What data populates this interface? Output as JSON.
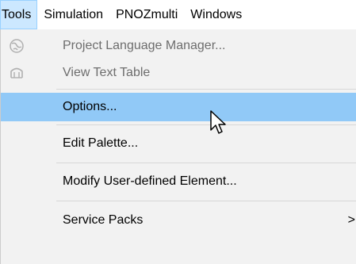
{
  "menubar": {
    "items": [
      {
        "label": "Tools"
      },
      {
        "label": "Simulation"
      },
      {
        "label": "PNOZmulti"
      },
      {
        "label": "Windows"
      }
    ]
  },
  "dropdown": {
    "items": [
      {
        "label": "Project Language Manager...",
        "icon": "globe-icon",
        "state": "disabled"
      },
      {
        "label": "View Text Table",
        "icon": "text-table-icon",
        "state": "disabled"
      },
      {
        "label": "Options...",
        "state": "highlighted"
      },
      {
        "label": "Edit Palette..."
      },
      {
        "label": "Modify User-defined Element..."
      },
      {
        "label": "Service Packs",
        "submenu_arrow": ">"
      }
    ]
  },
  "colors": {
    "menubar_active_bg": "#cce8ff",
    "highlight_bg": "#91c9f7",
    "menu_bg": "#f2f2f2",
    "disabled_text": "#6d6d6d"
  }
}
